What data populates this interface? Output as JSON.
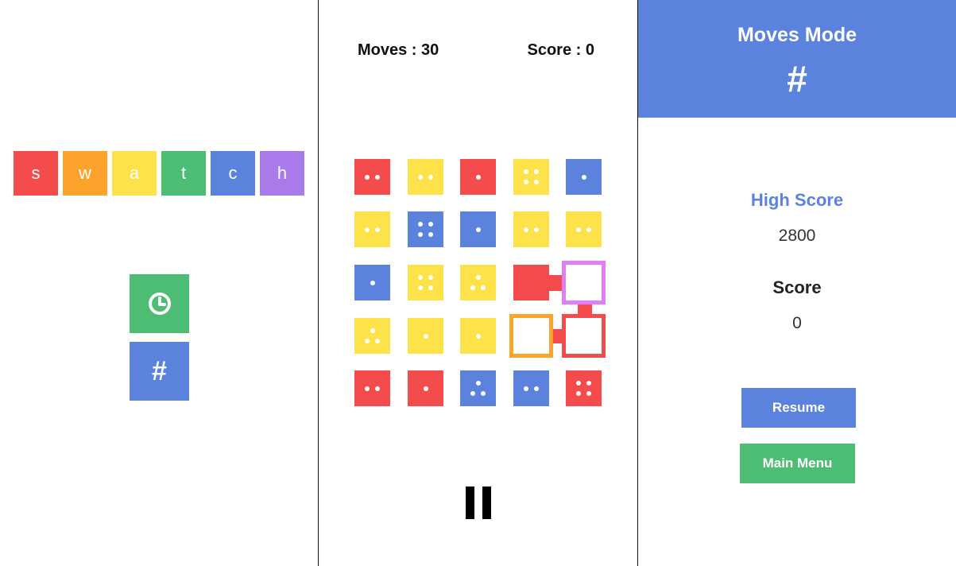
{
  "colors": {
    "red": "#f44c4c",
    "orange": "#fda22a",
    "yellow": "#fde24a",
    "green": "#4dbd74",
    "blue": "#5b83de",
    "purple": "#a97ae9",
    "select_purple": "#e17ef4"
  },
  "splash": {
    "logo_letters": [
      {
        "letter": "s",
        "color": "red"
      },
      {
        "letter": "w",
        "color": "orange"
      },
      {
        "letter": "a",
        "color": "yellow"
      },
      {
        "letter": "t",
        "color": "green"
      },
      {
        "letter": "c",
        "color": "blue"
      },
      {
        "letter": "h",
        "color": "purple"
      }
    ],
    "timed_mode_icon": "clock-icon",
    "moves_mode_label": "#"
  },
  "game": {
    "moves_label": "Moves :",
    "moves_value": "30",
    "score_label": "Score :",
    "score_value": "0",
    "board": [
      [
        {
          "color": "red",
          "pips": 2
        },
        {
          "color": "yellow",
          "pips": 2
        },
        {
          "color": "red",
          "pips": 1
        },
        {
          "color": "yellow",
          "pips": 4
        },
        {
          "color": "blue",
          "pips": 1
        }
      ],
      [
        {
          "color": "yellow",
          "pips": 2
        },
        {
          "color": "blue",
          "pips": 4
        },
        {
          "color": "blue",
          "pips": 1
        },
        {
          "color": "yellow",
          "pips": 2
        },
        {
          "color": "yellow",
          "pips": 2
        }
      ],
      [
        {
          "color": "blue",
          "pips": 1
        },
        {
          "color": "yellow",
          "pips": 4
        },
        {
          "color": "yellow",
          "pips": 3
        },
        {
          "color": "red",
          "pips": 0,
          "state": "linked"
        },
        {
          "color": "select_purple",
          "pips": 0,
          "state": "selected"
        }
      ],
      [
        {
          "color": "yellow",
          "pips": 3
        },
        {
          "color": "yellow",
          "pips": 1
        },
        {
          "color": "yellow",
          "pips": 1
        },
        {
          "color": "orange",
          "pips": 0,
          "state": "selected"
        },
        {
          "color": "red",
          "pips": 0,
          "state": "selected"
        }
      ],
      [
        {
          "color": "red",
          "pips": 2
        },
        {
          "color": "red",
          "pips": 1
        },
        {
          "color": "blue",
          "pips": 3
        },
        {
          "color": "blue",
          "pips": 2
        },
        {
          "color": "red",
          "pips": 4
        }
      ]
    ],
    "pause_icon": "pause-icon"
  },
  "pause_menu": {
    "mode_title": "Moves Mode",
    "mode_icon": "#",
    "high_score_label": "High Score",
    "high_score_value": "2800",
    "score_label": "Score",
    "score_value": "0",
    "resume_label": "Resume",
    "main_menu_label": "Main Menu"
  }
}
